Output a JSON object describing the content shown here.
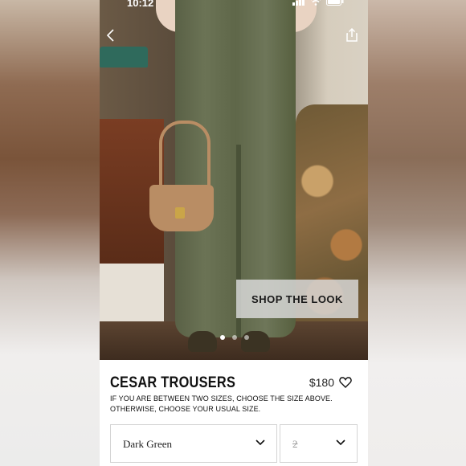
{
  "status_bar": {
    "time": "10:12"
  },
  "hero": {
    "shop_the_look_label": "SHOP THE LOOK",
    "slides_count": 3,
    "active_slide": 1
  },
  "product": {
    "name": "CESAR TROUSERS",
    "price": "$180",
    "size_note": "IF YOU ARE BETWEEN TWO SIZES, CHOOSE THE SIZE ABOVE. OTHERWISE, CHOOSE YOUR USUAL SIZE.",
    "color_select": {
      "value": "Dark Green"
    },
    "size_select": {
      "value": "2"
    }
  },
  "icons": {
    "back": "chevron-left-icon",
    "share": "share-icon",
    "favorite": "heart-icon",
    "dropdown": "chevron-down-icon"
  }
}
